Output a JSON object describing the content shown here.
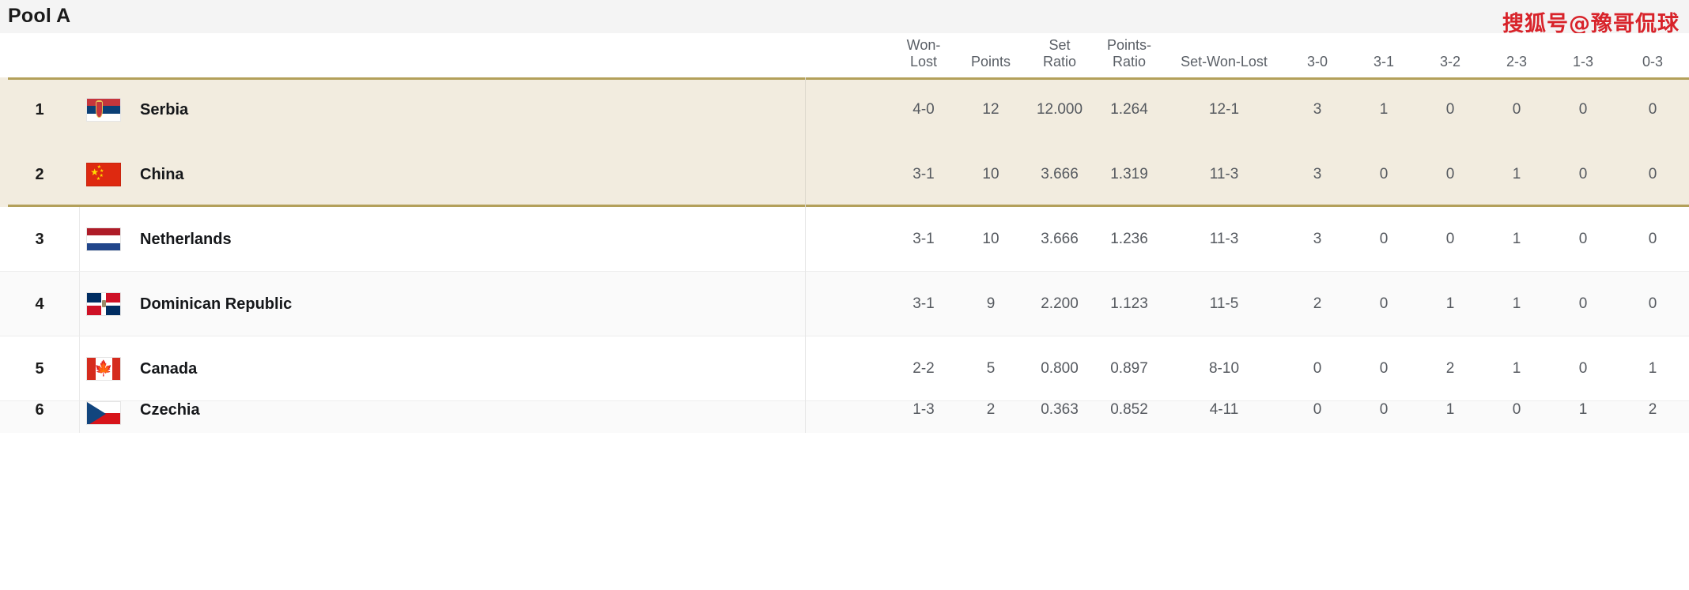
{
  "header": {
    "pool_title": "Pool A",
    "watermark": "搜狐号@豫哥侃球",
    "watermark_color": "#d8232a"
  },
  "table": {
    "columns": [
      {
        "key": "rank",
        "label": ""
      },
      {
        "key": "flag",
        "label": ""
      },
      {
        "key": "team",
        "label": ""
      },
      {
        "key": "won_lost",
        "label": "Won-\nLost"
      },
      {
        "key": "points",
        "label": "Points"
      },
      {
        "key": "set_ratio",
        "label": "Set\nRatio"
      },
      {
        "key": "points_ratio",
        "label": "Points-\nRatio"
      },
      {
        "key": "set_won_lost",
        "label": "Set-Won-Lost"
      },
      {
        "key": "r30",
        "label": "3-0"
      },
      {
        "key": "r31",
        "label": "3-1"
      },
      {
        "key": "r32",
        "label": "3-2"
      },
      {
        "key": "r23",
        "label": "2-3"
      },
      {
        "key": "r13",
        "label": "1-3"
      },
      {
        "key": "r03",
        "label": "0-3"
      }
    ],
    "qualified_background": "#f2ecdf",
    "qualified_border_color": "#b3a05a",
    "rows": [
      {
        "rank": "1",
        "team": "Serbia",
        "flag": "serbia",
        "qualified": true,
        "won_lost": "4-0",
        "points": "12",
        "set_ratio": "12.000",
        "points_ratio": "1.264",
        "set_won_lost": "12-1",
        "r30": "3",
        "r31": "1",
        "r32": "0",
        "r23": "0",
        "r13": "0",
        "r03": "0"
      },
      {
        "rank": "2",
        "team": "China",
        "flag": "china",
        "qualified": true,
        "won_lost": "3-1",
        "points": "10",
        "set_ratio": "3.666",
        "points_ratio": "1.319",
        "set_won_lost": "11-3",
        "r30": "3",
        "r31": "0",
        "r32": "0",
        "r23": "1",
        "r13": "0",
        "r03": "0"
      },
      {
        "rank": "3",
        "team": "Netherlands",
        "flag": "netherlands",
        "qualified": false,
        "won_lost": "3-1",
        "points": "10",
        "set_ratio": "3.666",
        "points_ratio": "1.236",
        "set_won_lost": "11-3",
        "r30": "3",
        "r31": "0",
        "r32": "0",
        "r23": "1",
        "r13": "0",
        "r03": "0"
      },
      {
        "rank": "4",
        "team": "Dominican Republic",
        "flag": "dominican",
        "qualified": false,
        "won_lost": "3-1",
        "points": "9",
        "set_ratio": "2.200",
        "points_ratio": "1.123",
        "set_won_lost": "11-5",
        "r30": "2",
        "r31": "0",
        "r32": "1",
        "r23": "1",
        "r13": "0",
        "r03": "0"
      },
      {
        "rank": "5",
        "team": "Canada",
        "flag": "canada",
        "qualified": false,
        "won_lost": "2-2",
        "points": "5",
        "set_ratio": "0.800",
        "points_ratio": "0.897",
        "set_won_lost": "8-10",
        "r30": "0",
        "r31": "0",
        "r32": "2",
        "r23": "1",
        "r13": "0",
        "r03": "1"
      },
      {
        "rank": "6",
        "team": "Czechia",
        "flag": "czechia",
        "qualified": false,
        "won_lost": "1-3",
        "points": "2",
        "set_ratio": "0.363",
        "points_ratio": "0.852",
        "set_won_lost": "4-11",
        "r30": "0",
        "r31": "0",
        "r32": "1",
        "r23": "0",
        "r13": "1",
        "r03": "2"
      }
    ]
  }
}
